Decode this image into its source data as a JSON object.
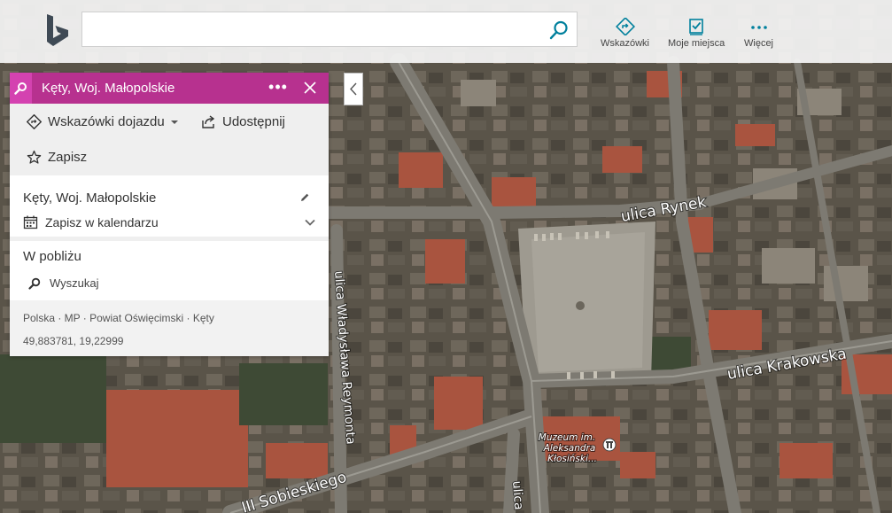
{
  "topbar": {
    "search": {
      "value": "",
      "placeholder": ""
    },
    "buttons": [
      {
        "id": "directions",
        "label": "Wskazówki",
        "icon": "directions-icon"
      },
      {
        "id": "my-places",
        "label": "Moje miejsca",
        "icon": "my-places-icon"
      },
      {
        "id": "more",
        "label": "Więcej",
        "icon": "more-dots-icon"
      }
    ]
  },
  "panel": {
    "title": "Kęty, Woj. Małopolskie",
    "more_label": "•••",
    "actions": {
      "directions": "Wskazówki dojazdu",
      "share": "Udostępnij",
      "save": "Zapisz"
    },
    "location_name": "Kęty, Woj. Małopolskie",
    "calendar_label": "Zapisz w kalendarzu",
    "nearby": {
      "title": "W pobliżu",
      "search_label": "Wyszukaj"
    },
    "breadcrumb": "Polska · MP · Powiat Oświęcimski · Kęty",
    "coordinates": "49,883781, 19,22999"
  },
  "map": {
    "streets": [
      "ulica Rynek",
      "ulica Krakowska",
      "ulica Władysława Reymonta",
      "III Sobieskiego",
      "ulica"
    ],
    "poi": [
      "Muzeum im.",
      "Aleksandra",
      "Kłosiński..."
    ]
  },
  "colors": {
    "header": "#b7318f",
    "header_icon_bg": "#d442b0",
    "accent": "#00809d"
  }
}
